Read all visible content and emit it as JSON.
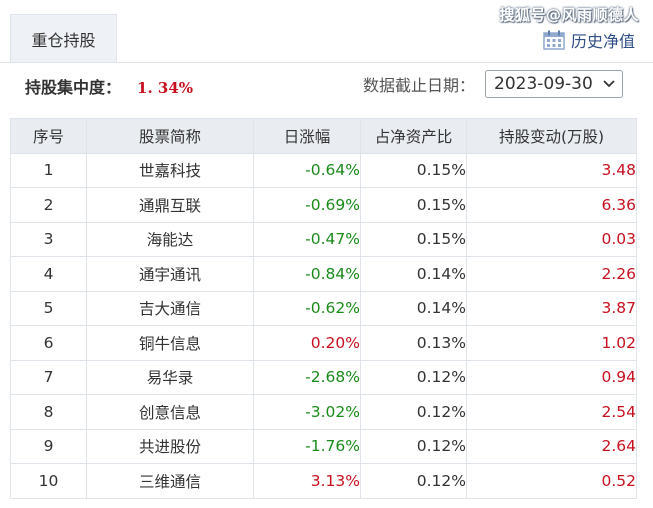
{
  "tab": {
    "label": "重仓持股"
  },
  "watermark": "搜狐号@风雨顺德人",
  "history_link": {
    "label": "历史净值",
    "icon": "calendar-icon"
  },
  "summary": {
    "concentration_label": "持股集中度：",
    "concentration_value": "1. 34%"
  },
  "date_filter": {
    "label": "数据截止日期：",
    "selected": "2023-09-30"
  },
  "colors": {
    "up": "#c8101e",
    "down": "#1a8a1a",
    "header_bg": "#e9edf2",
    "link": "#2f4f86"
  },
  "table": {
    "headers": [
      "序号",
      "股票简称",
      "日涨幅",
      "占净资产比",
      "持股变动(万股)"
    ],
    "rows": [
      {
        "idx": "1",
        "name": "世嘉科技",
        "change": "-0.64%",
        "dir": "down",
        "pct": "0.15%",
        "volume": "3.48"
      },
      {
        "idx": "2",
        "name": "通鼎互联",
        "change": "-0.69%",
        "dir": "down",
        "pct": "0.15%",
        "volume": "6.36"
      },
      {
        "idx": "3",
        "name": "海能达",
        "change": "-0.47%",
        "dir": "down",
        "pct": "0.15%",
        "volume": "0.03"
      },
      {
        "idx": "4",
        "name": "通宇通讯",
        "change": "-0.84%",
        "dir": "down",
        "pct": "0.14%",
        "volume": "2.26"
      },
      {
        "idx": "5",
        "name": "吉大通信",
        "change": "-0.62%",
        "dir": "down",
        "pct": "0.14%",
        "volume": "3.87"
      },
      {
        "idx": "6",
        "name": "铜牛信息",
        "change": "0.20%",
        "dir": "up",
        "pct": "0.13%",
        "volume": "1.02"
      },
      {
        "idx": "7",
        "name": "易华录",
        "change": "-2.68%",
        "dir": "down",
        "pct": "0.12%",
        "volume": "0.94"
      },
      {
        "idx": "8",
        "name": "创意信息",
        "change": "-3.02%",
        "dir": "down",
        "pct": "0.12%",
        "volume": "2.54"
      },
      {
        "idx": "9",
        "name": "共进股份",
        "change": "-1.76%",
        "dir": "down",
        "pct": "0.12%",
        "volume": "2.64"
      },
      {
        "idx": "10",
        "name": "三维通信",
        "change": "3.13%",
        "dir": "up",
        "pct": "0.12%",
        "volume": "0.52"
      }
    ]
  }
}
